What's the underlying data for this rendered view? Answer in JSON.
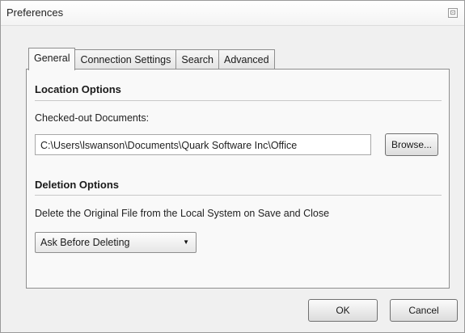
{
  "window": {
    "title": "Preferences",
    "close_glyph": "⊡"
  },
  "tabs": [
    {
      "label": "General",
      "active": true
    },
    {
      "label": "Connection Settings",
      "active": false
    },
    {
      "label": "Search",
      "active": false
    },
    {
      "label": "Advanced",
      "active": false
    }
  ],
  "location": {
    "section_title": "Location Options",
    "field_label": "Checked-out Documents:",
    "path_value": "C:\\Users\\lswanson\\Documents\\Quark Software Inc\\Office",
    "browse_label": "Browse..."
  },
  "deletion": {
    "section_title": "Deletion Options",
    "description": "Delete the Original File from the Local System on Save and Close",
    "select_value": "Ask Before Deleting",
    "select_arrow": "▼"
  },
  "footer": {
    "ok_label": "OK",
    "cancel_label": "Cancel"
  }
}
